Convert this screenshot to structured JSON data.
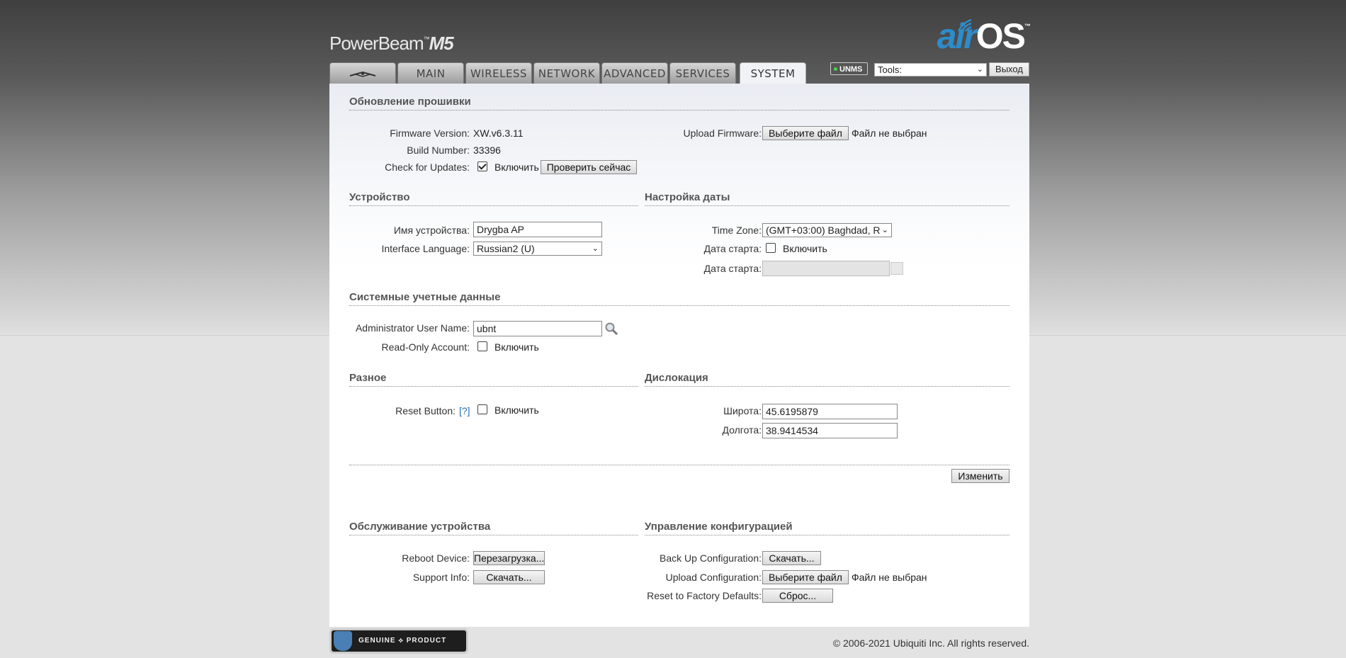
{
  "header": {
    "product_name": "PowerBeam",
    "product_tm": "™",
    "product_model": "M5",
    "logo_air": "air",
    "logo_os": "OS",
    "logo_tm": "™"
  },
  "tabs": [
    {
      "label": "",
      "icon": "ubiquiti-logo-icon"
    },
    {
      "label": "MAIN"
    },
    {
      "label": "WIRELESS"
    },
    {
      "label": "NETWORK"
    },
    {
      "label": "ADVANCED"
    },
    {
      "label": "SERVICES"
    },
    {
      "label": "SYSTEM",
      "active": true
    }
  ],
  "topbar": {
    "unms_label": "UNMS",
    "unms_status_color": "#49d24a",
    "tools_value": "Tools:",
    "logout_label": "Выход"
  },
  "firmware": {
    "title": "Обновление прошивки",
    "version_label": "Firmware Version:",
    "version_value": "XW.v6.3.11",
    "build_label": "Build Number:",
    "build_value": "33396",
    "check_label": "Check for Updates:",
    "check_enable": "Включить",
    "check_enabled": true,
    "check_now_button": "Проверить сейчас",
    "upload_label": "Upload Firmware:",
    "choose_file_button": "Выберите файл",
    "no_file": "Файл не выбран"
  },
  "device": {
    "title": "Устройство",
    "name_label": "Имя устройства:",
    "name_value": "Drygba AP",
    "language_label": "Interface Language:",
    "language_value": "Russian2 (U)"
  },
  "date_settings": {
    "title": "Настройка даты",
    "timezone_label": "Time Zone:",
    "timezone_value": "(GMT+03:00) Baghdad, R",
    "start_date_label": "Дата старта:",
    "start_date_enable": "Включить",
    "start_date_label2": "Дата старта:",
    "start_date_value": ""
  },
  "accounts": {
    "title": "Системные учетные данные",
    "admin_label": "Administrator User Name:",
    "admin_value": "ubnt",
    "readonly_label": "Read-Only Account:",
    "readonly_enable": "Включить"
  },
  "misc": {
    "title": "Разное",
    "reset_label": "Reset Button:",
    "reset_help": "[?]",
    "reset_enable": "Включить"
  },
  "location": {
    "title": "Дислокация",
    "lat_label": "Широта:",
    "lat_value": "45.6195879",
    "lon_label": "Долгота:",
    "lon_value": "38.9414534"
  },
  "change_button": "Изменить",
  "maintenance": {
    "title": "Обслуживание устройства",
    "reboot_label": "Reboot Device:",
    "reboot_button": "Перезагрузка...",
    "support_label": "Support Info:",
    "support_button": "Скачать..."
  },
  "config": {
    "title": "Управление конфигурацией",
    "backup_label": "Back Up Configuration:",
    "backup_button": "Скачать...",
    "upload_label": "Upload Configuration:",
    "choose_file_button": "Выберите файл",
    "no_file": "Файл не выбран",
    "reset_label": "Reset to Factory Defaults:",
    "reset_button": "Сброс..."
  },
  "footer": {
    "badge_text": "GENUINE ⟡ PRODUCT",
    "copyright": "© 2006-2021 Ubiquiti Inc. All rights reserved."
  }
}
